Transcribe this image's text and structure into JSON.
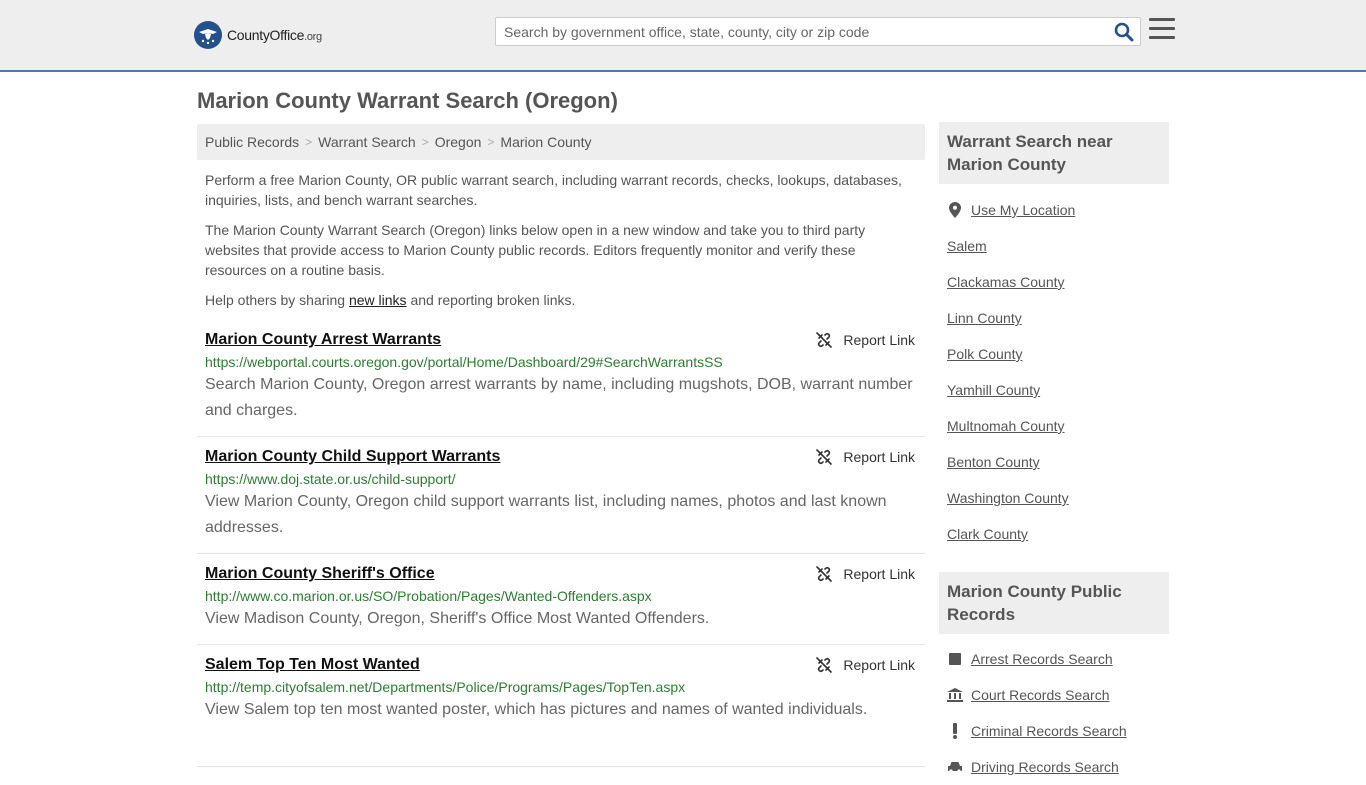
{
  "header": {
    "logo_main": "CountyOffice",
    "logo_suffix": ".org",
    "search_placeholder": "Search by government office, state, county, city or zip code"
  },
  "page": {
    "title": "Marion County Warrant Search (Oregon)"
  },
  "breadcrumb": [
    "Public Records",
    "Warrant Search",
    "Oregon",
    "Marion County"
  ],
  "intro": {
    "p1": "Perform a free Marion County, OR public warrant search, including warrant records, checks, lookups, databases, inquiries, lists, and bench warrant searches.",
    "p2": "The Marion County Warrant Search (Oregon) links below open in a new window and take you to third party websites that provide access to Marion County public records. Editors frequently monitor and verify these resources on a routine basis.",
    "p3_before": "Help others by sharing ",
    "p3_link": "new links",
    "p3_after": " and reporting broken links."
  },
  "report_label": "Report Link",
  "listings": [
    {
      "title": "Marion County Arrest Warrants",
      "url": "https://webportal.courts.oregon.gov/portal/Home/Dashboard/29#SearchWarrantsSS",
      "desc": "Search Marion County, Oregon arrest warrants by name, including mugshots, DOB, warrant number and charges."
    },
    {
      "title": "Marion County Child Support Warrants",
      "url": "https://www.doj.state.or.us/child-support/",
      "desc": "View Marion County, Oregon child support warrants list, including names, photos and last known addresses."
    },
    {
      "title": "Marion County Sheriff's Office",
      "url": "http://www.co.marion.or.us/SO/Probation/Pages/Wanted-Offenders.aspx",
      "desc": "View Madison County, Oregon, Sheriff's Office Most Wanted Offenders."
    },
    {
      "title": "Salem Top Ten Most Wanted",
      "url": "http://temp.cityofsalem.net/Departments/Police/Programs/Pages/TopTen.aspx",
      "desc": "View Salem top ten most wanted poster, which has pictures and names of wanted individuals."
    }
  ],
  "sidebar": {
    "nearby_title": "Warrant Search near Marion County",
    "use_location": "Use My Location",
    "nearby": [
      "Salem",
      "Clackamas County",
      "Linn County",
      "Polk County",
      "Yamhill County",
      "Multnomah County",
      "Benton County",
      "Washington County",
      "Clark County"
    ],
    "records_title": "Marion County Public Records",
    "records": [
      {
        "label": "Arrest Records Search",
        "icon": "square-icon"
      },
      {
        "label": "Court Records Search",
        "icon": "courthouse-icon"
      },
      {
        "label": "Criminal Records Search",
        "icon": "exclamation-icon"
      },
      {
        "label": "Driving Records Search",
        "icon": "car-icon"
      }
    ]
  }
}
